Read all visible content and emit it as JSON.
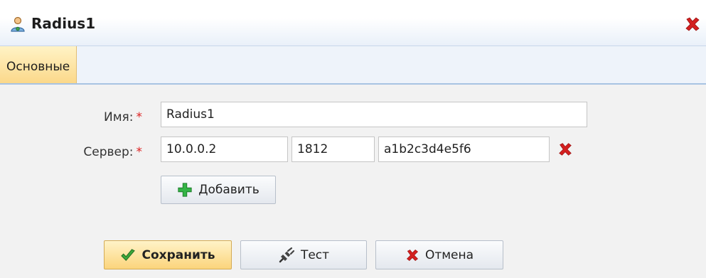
{
  "window": {
    "title": "Radius1",
    "icons": {
      "title": "user-settings-icon",
      "close": "close-icon"
    },
    "accent_color": "#fbd47c",
    "close_color": "#d42020"
  },
  "tabs": [
    {
      "label": "Основные",
      "active": true
    }
  ],
  "form": {
    "name_label": "Имя:",
    "server_label": "Сервер:",
    "required_mark": "*",
    "name_value": "Radius1",
    "server": {
      "address": "10.0.0.2",
      "port": "1812",
      "secret": "a1b2c3d4e5f6"
    },
    "add_button": "Добавить"
  },
  "footer": {
    "save": "Сохранить",
    "test": "Тест",
    "cancel": "Отмена"
  }
}
